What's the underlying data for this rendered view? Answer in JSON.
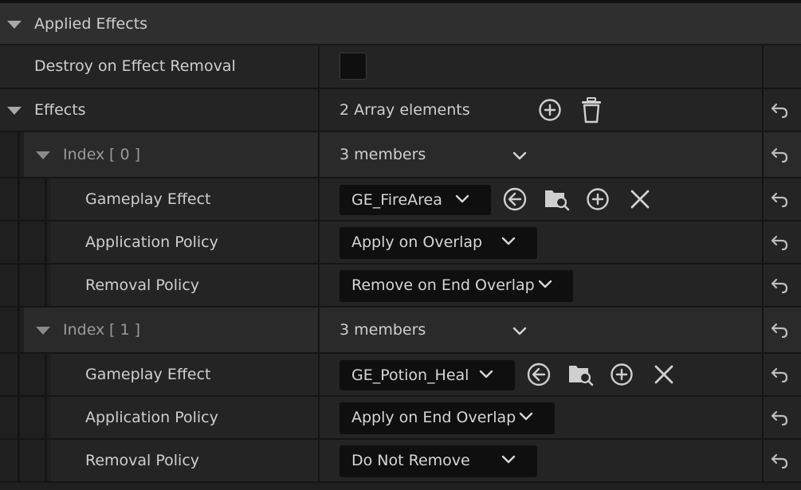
{
  "section": {
    "title": "Applied Effects"
  },
  "destroy_row": {
    "label": "Destroy on Effect Removal",
    "checked": false
  },
  "effects": {
    "label": "Effects",
    "summary": "2 Array elements",
    "icons": [
      "add-element-icon",
      "delete-all-icon",
      "reset-icon"
    ]
  },
  "elements": [
    {
      "index_label": "Index",
      "index_value": "[ 0 ]",
      "members": "3 members",
      "gameplay_effect_label": "Gameplay Effect",
      "gameplay_effect_value": "GE_FireArea",
      "application_policy_label": "Application Policy",
      "application_policy_value": "Apply on Overlap",
      "removal_policy_label": "Removal Policy",
      "removal_policy_value": "Remove on End Overlap"
    },
    {
      "index_label": "Index",
      "index_value": "[ 1 ]",
      "members": "3 members",
      "gameplay_effect_label": "Gameplay Effect",
      "gameplay_effect_value": "GE_Potion_Heal",
      "application_policy_label": "Application Policy",
      "application_policy_value": "Apply on End Overlap",
      "removal_policy_label": "Removal Policy",
      "removal_policy_value": "Do Not Remove"
    }
  ],
  "colors": {
    "background": "#1a1a1a",
    "row": "#242424",
    "header": "#2f2f2f",
    "dropdown": "#0f0f0f",
    "text": "#cfcfcf"
  }
}
